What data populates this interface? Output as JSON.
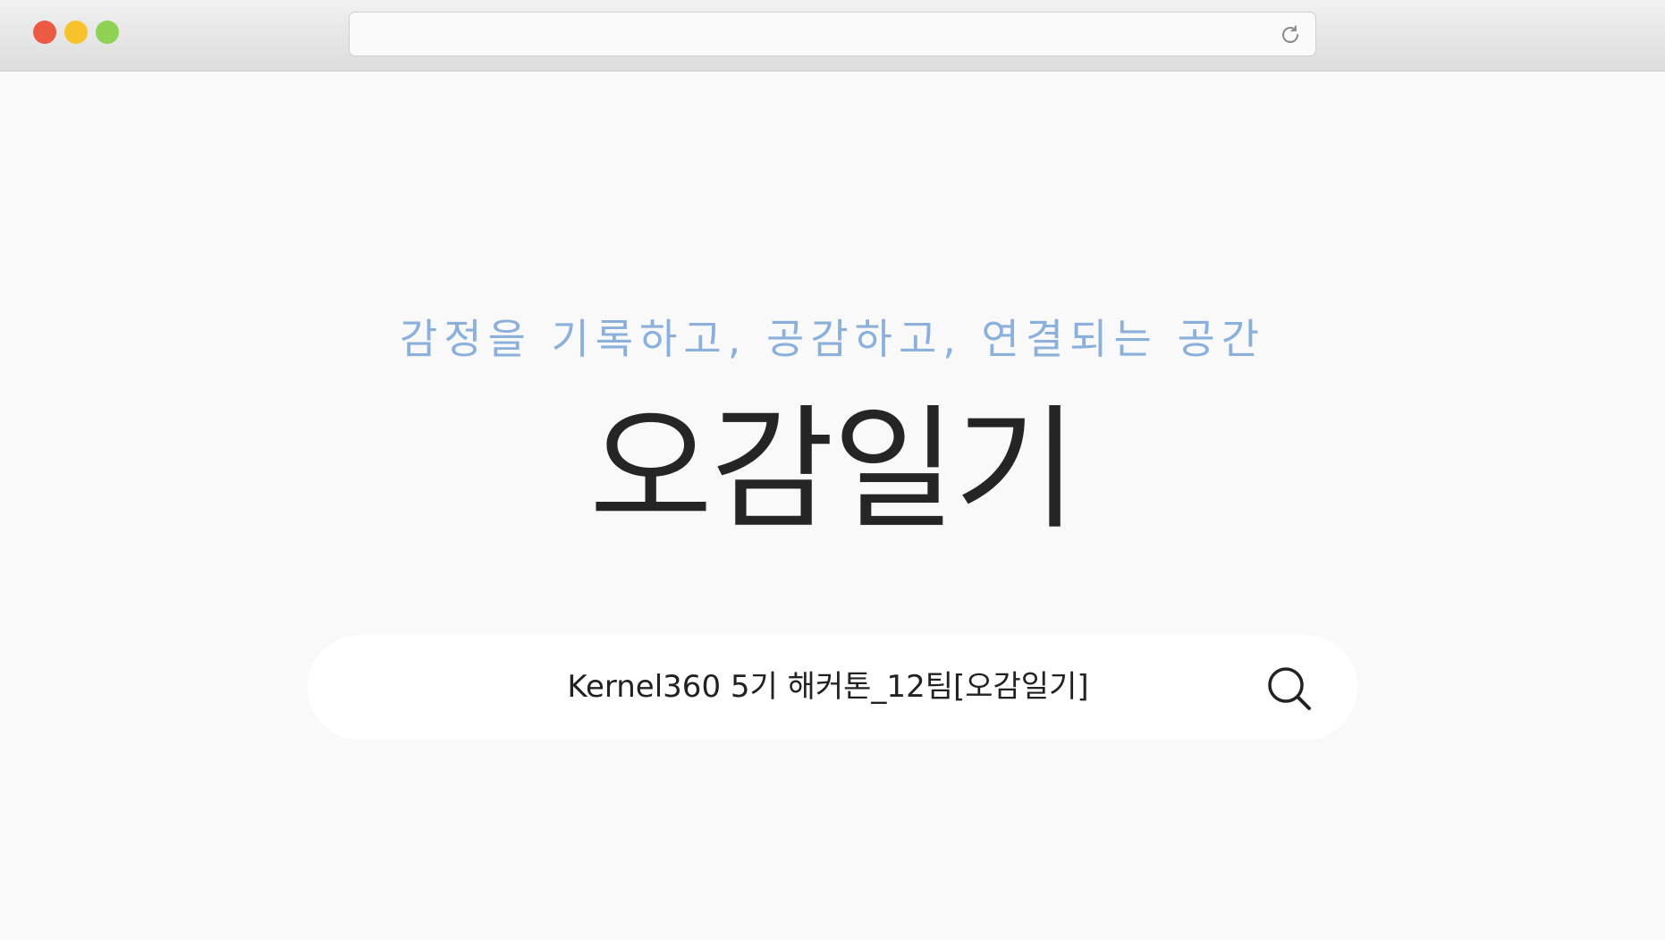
{
  "browser": {
    "address_value": "",
    "icons": {
      "close": "close-window-dot",
      "minimize": "minimize-window-dot",
      "maximize": "maximize-window-dot",
      "reload": "reload-icon"
    },
    "colors": {
      "close": "#ec5a44",
      "minimize": "#f8c22d",
      "maximize": "#8fd153"
    }
  },
  "page": {
    "tagline": "감정을 기록하고, 공감하고, 연결되는 공간",
    "title": "오감일기",
    "search": {
      "value": "Kernel360 5기 해커톤_12팀[오감일기]",
      "icon": "search-icon"
    },
    "colors": {
      "tagline": "#8bb0dc",
      "title": "#252525",
      "background": "#f9f9f9"
    }
  }
}
